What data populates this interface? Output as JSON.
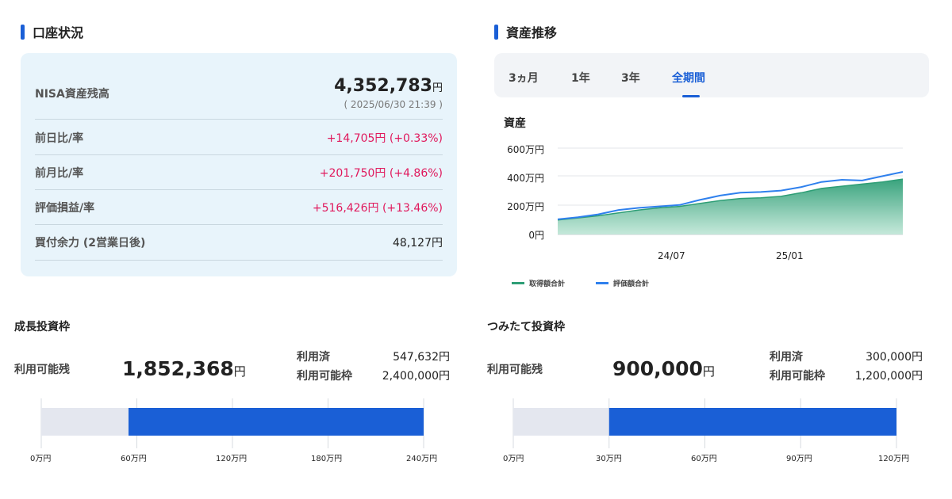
{
  "account": {
    "title": "口座状況",
    "nisa_label": "NISA資産残高",
    "nisa_value": "4,352,783",
    "unit": "円",
    "nisa_date": "( 2025/06/30 21:39 )",
    "rows": [
      {
        "label": "前日比/率",
        "value": "+14,705円 (+0.33%)",
        "color": "#e0185c"
      },
      {
        "label": "前月比/率",
        "value": "+201,750円 (+4.86%)",
        "color": "#e0185c"
      },
      {
        "label": "評価損益/率",
        "value": "+516,426円 (+13.46%)",
        "color": "#e0185c"
      },
      {
        "label": "買付余力 (2営業日後)",
        "value": "48,127円",
        "color": "#222222"
      }
    ]
  },
  "assets": {
    "title": "資産推移",
    "tabs": [
      {
        "label": "3ヵ月",
        "active": false
      },
      {
        "label": "1年",
        "active": false
      },
      {
        "label": "3年",
        "active": false
      },
      {
        "label": "全期間",
        "active": true
      }
    ],
    "chart_heading": "資産"
  },
  "chart_data": {
    "type": "area",
    "title": "資産",
    "y_unit": "万円",
    "y_ticks": [
      "600万円",
      "400万円",
      "200万円",
      "0円"
    ],
    "x_ticks": [
      "24/07",
      "25/01"
    ],
    "ylim": [
      0,
      6000000
    ],
    "grid": true,
    "legend_position": "bottom-left",
    "x": [
      "2024-01",
      "2024-02",
      "2024-03",
      "2024-04",
      "2024-05",
      "2024-06",
      "2024-07",
      "2024-08",
      "2024-09",
      "2024-10",
      "2024-11",
      "2024-12",
      "2025-01",
      "2025-02",
      "2025-03",
      "2025-04",
      "2025-05",
      "2025-06"
    ],
    "series": [
      {
        "name": "取得額合計",
        "color": "#2e9e76",
        "values": [
          1000000,
          1150000,
          1300000,
          1500000,
          1700000,
          1850000,
          1950000,
          2150000,
          2350000,
          2500000,
          2550000,
          2650000,
          2900000,
          3200000,
          3350000,
          3500000,
          3650000,
          3850000
        ]
      },
      {
        "name": "評価額合計",
        "color": "#2f80ed",
        "values": [
          1050000,
          1200000,
          1400000,
          1700000,
          1850000,
          1950000,
          2050000,
          2400000,
          2700000,
          2900000,
          2950000,
          3050000,
          3300000,
          3650000,
          3800000,
          3750000,
          4050000,
          4350000
        ]
      }
    ]
  },
  "growth": {
    "title": "成長投資枠",
    "avail_label": "利用可能残",
    "avail_value": "1,852,368",
    "unit": "円",
    "used_label": "利用済",
    "used_value": "547,632円",
    "limit_label": "利用可能枠",
    "limit_value": "2,400,000円",
    "used_fraction": 0.2282,
    "ticks": [
      "0万円",
      "60万円",
      "120万円",
      "180万円",
      "240万円"
    ]
  },
  "tsumitate": {
    "title": "つみたて投資枠",
    "avail_label": "利用可能残",
    "avail_value": "900,000",
    "unit": "円",
    "used_label": "利用済",
    "used_value": "300,000円",
    "limit_label": "利用可能枠",
    "limit_value": "1,200,000円",
    "used_fraction": 0.25,
    "ticks": [
      "0万円",
      "30万円",
      "60万円",
      "90万円",
      "120万円"
    ]
  },
  "colors": {
    "accent": "#1a5fd6",
    "used_bar": "#e4e7ef",
    "positive": "#e0185c"
  }
}
